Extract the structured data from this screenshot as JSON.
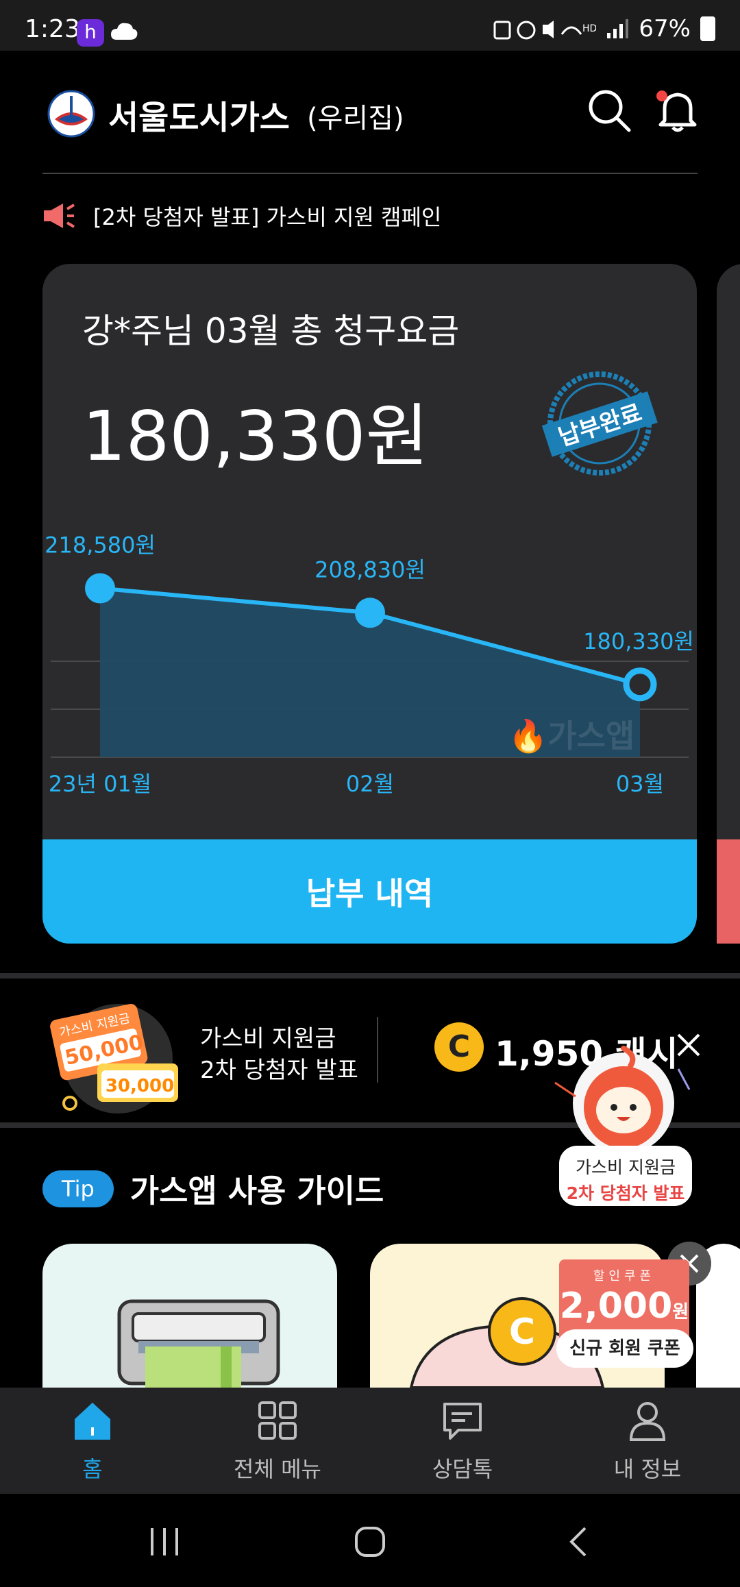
{
  "status_bar": {
    "time": "1:23",
    "app_icon_letter": "h",
    "battery": "67%"
  },
  "header": {
    "brand": "서울도시가스",
    "sub": "(우리집)",
    "notice": "[2차 당첨자 발표] 가스비 지원 캠페인"
  },
  "bill": {
    "label": "강*주님 03월 총 청구요금",
    "amount": "180,330원",
    "stamp": "납부완료",
    "pay_button": "납부 내역"
  },
  "chart_data": {
    "type": "area",
    "categories": [
      "23년 01월",
      "02월",
      "03월"
    ],
    "values": [
      218580,
      208830,
      180330
    ],
    "value_labels": [
      "218,580원",
      "208,830원",
      "180,330원"
    ],
    "watermark": "가스앱",
    "grid": true,
    "series_color": "#29b6f6",
    "fill_color": "#214c65"
  },
  "promo": {
    "image_top": "가스비 지원금",
    "image_amt1": "50,000",
    "image_amt2": "30,000",
    "line1": "가스비 지원금",
    "line2": "2차 당첨자 발표",
    "coin_letter": "C",
    "cash": "1,950 캐시"
  },
  "float_banner": {
    "line1": "가스비 지원금",
    "line2": "2차 당첨자 발표"
  },
  "tip": {
    "badge": "Tip",
    "title": "가스앱 사용 가이드"
  },
  "coupon": {
    "top": "할인쿠폰",
    "amount": "2,000",
    "unit": "원",
    "label": "신규 회원 쿠폰"
  },
  "bottom_nav": {
    "items": [
      {
        "label": "홈",
        "icon": "home-icon"
      },
      {
        "label": "전체 메뉴",
        "icon": "grid-icon"
      },
      {
        "label": "상담톡",
        "icon": "chat-icon"
      },
      {
        "label": "내 정보",
        "icon": "user-icon"
      }
    ]
  },
  "colors": {
    "accent": "#1fb5f2",
    "nav_active": "#1fa7ea",
    "card": "#2b2b2d",
    "notice_icon": "#f06a6a"
  }
}
